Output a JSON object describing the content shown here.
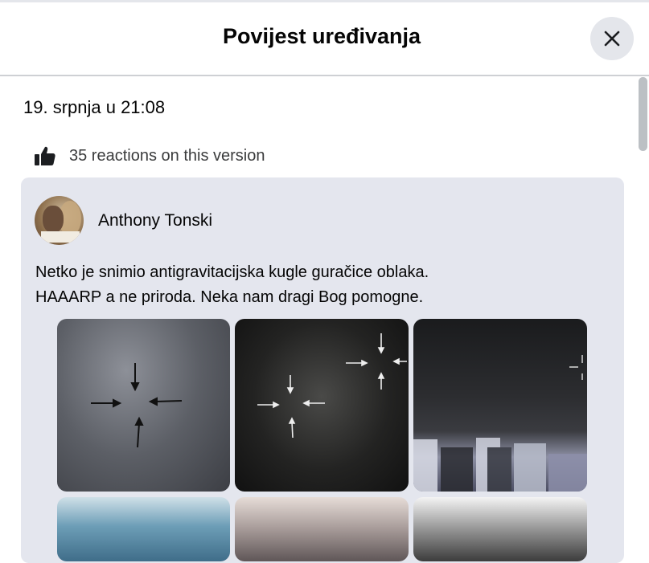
{
  "dialog": {
    "title": "Povijest uređivanja",
    "close_icon": "close-icon"
  },
  "version": {
    "date": "19. srpnja u 21:08",
    "reactions_icon": "thumbs-up-icon",
    "reactions_text": "35 reactions on this version"
  },
  "post": {
    "author": "Anthony Tonski",
    "text_line1": "Netko je snimio antigravitacijska kugle guračice oblaka.",
    "text_line2": "HAAARP a ne priroda. Neka nam dragi Bog pomogne.",
    "photos": [
      {
        "description_icon": "sky-photo-arrows"
      },
      {
        "description_icon": "night-sky-photo-arrows"
      },
      {
        "description_icon": "city-inverted-photo"
      },
      {
        "description_icon": "cloud-photo"
      },
      {
        "description_icon": "cloud-photo"
      },
      {
        "description_icon": "cloud-photo"
      }
    ]
  },
  "colors": {
    "close_button_bg": "#e4e6eb",
    "card_bg": "#e4e6ee",
    "scrollbar_thumb": "#bcc0c4"
  }
}
